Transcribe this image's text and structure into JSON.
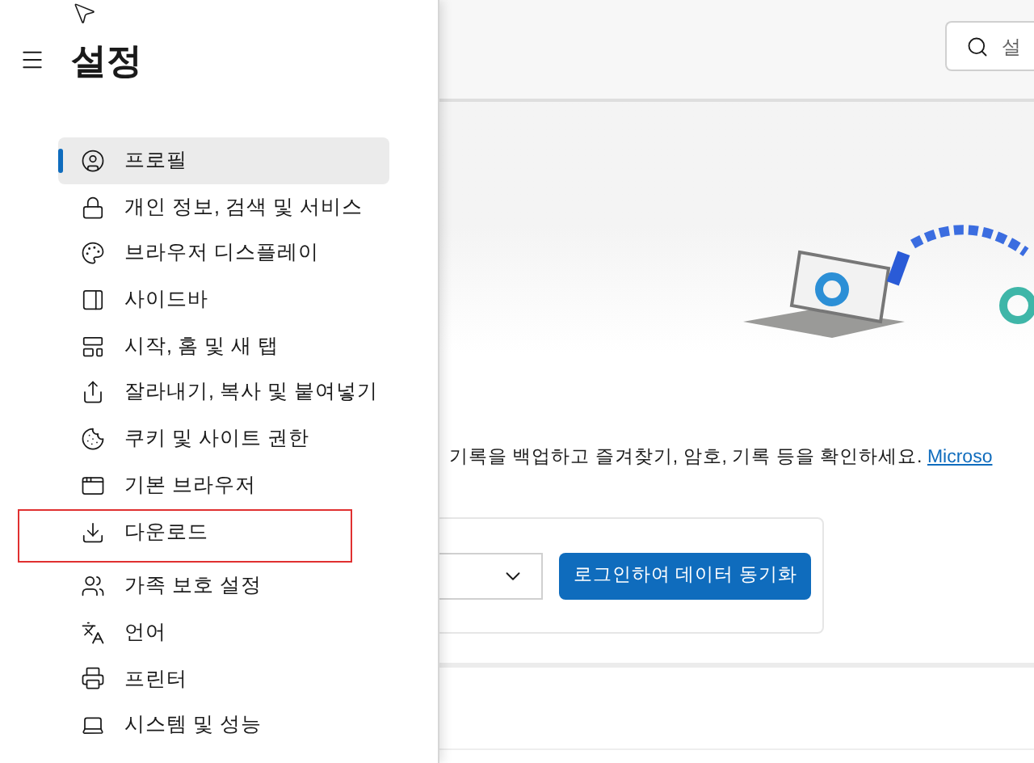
{
  "header": {
    "title": "설정"
  },
  "sidebar": {
    "items": [
      {
        "label": "프로필",
        "selected": true,
        "outlined": false
      },
      {
        "label": "개인 정보, 검색 및 서비스",
        "selected": false,
        "outlined": false
      },
      {
        "label": "브라우저 디스플레이",
        "selected": false,
        "outlined": false
      },
      {
        "label": "사이드바",
        "selected": false,
        "outlined": false
      },
      {
        "label": "시작, 홈 및 새 탭",
        "selected": false,
        "outlined": false
      },
      {
        "label": "잘라내기, 복사 및 붙여넣기",
        "selected": false,
        "outlined": false
      },
      {
        "label": "쿠키 및 사이트 권한",
        "selected": false,
        "outlined": false
      },
      {
        "label": "기본 브라우저",
        "selected": false,
        "outlined": false
      },
      {
        "label": "다운로드",
        "selected": false,
        "outlined": true
      },
      {
        "label": "가족 보호 설정",
        "selected": false,
        "outlined": false
      },
      {
        "label": "언어",
        "selected": false,
        "outlined": false
      },
      {
        "label": "프린터",
        "selected": false,
        "outlined": false
      },
      {
        "label": "시스템 및 성능",
        "selected": false,
        "outlined": false
      }
    ]
  },
  "search": {
    "placeholder": "설"
  },
  "sync": {
    "description": "기록을 백업하고 즐겨찾기, 암호, 기록 등을 확인하세요.",
    "link": "Microso",
    "button": "로그인하여 데이터 동기화"
  }
}
